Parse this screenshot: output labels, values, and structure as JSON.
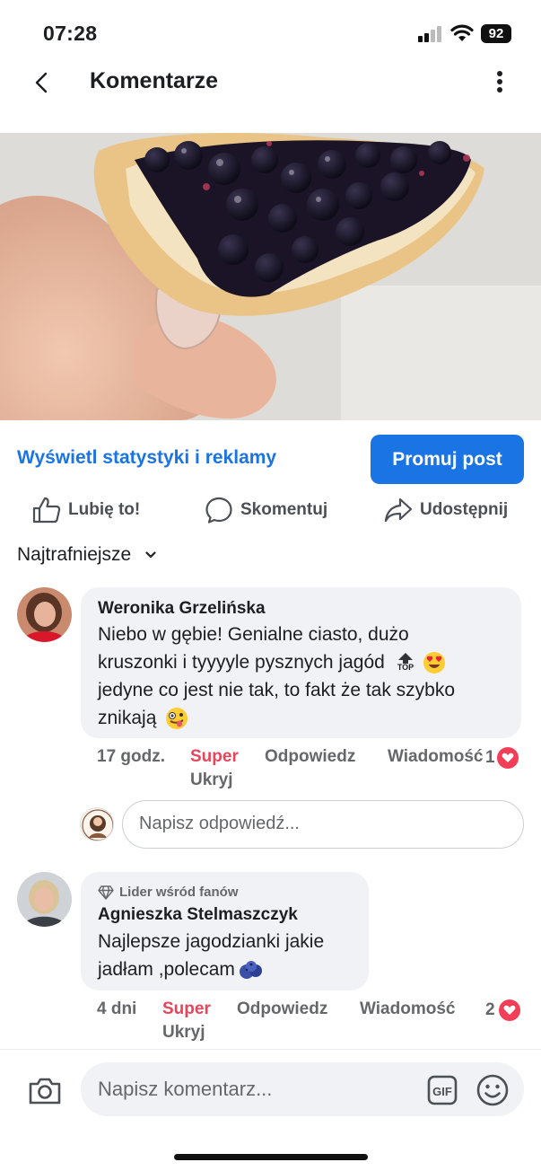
{
  "status": {
    "time": "07:28",
    "battery": "92"
  },
  "nav": {
    "title": "Komentarze"
  },
  "post": {
    "stats_link": "Wyświetl statystyki i reklamy",
    "promote_button": "Promuj post",
    "actions": {
      "like": "Lubię to!",
      "comment": "Skomentuj",
      "share": "Udostępnij"
    }
  },
  "sort": {
    "label": "Najtrafniejsze"
  },
  "comments": [
    {
      "author": "Weronika Grzelińska",
      "text_lines": [
        "Niebo w gębie! Genialne ciasto, dużo",
        "kruszonki i tyyyyle pysznych jagód",
        "jedyne co jest nie tak, to fakt że tak szybko",
        "znikają"
      ],
      "time": "17 godz.",
      "reaction": "Super",
      "reply": "Odpowiedz",
      "message": "Wiadomość",
      "like_count": "1",
      "hide": "Ukryj"
    },
    {
      "badge": "Lider wśród fanów",
      "author": "Agnieszka Stelmaszczyk",
      "text_lines": [
        "Najlepsze jagodzianki jakie",
        "jadłam ,polecam"
      ],
      "time": "4 dni",
      "reaction": "Super",
      "reply": "Odpowiedz",
      "message": "Wiadomość",
      "like_count": "2",
      "hide": "Ukryj"
    }
  ],
  "reply_box": {
    "placeholder": "Napisz odpowiedź..."
  },
  "composer": {
    "placeholder": "Napisz komentarz..."
  },
  "colors": {
    "accent": "#1b74e4",
    "heart": "#f33e58",
    "reaction_red": "#e8445a",
    "bubble": "#f0f2f5"
  }
}
